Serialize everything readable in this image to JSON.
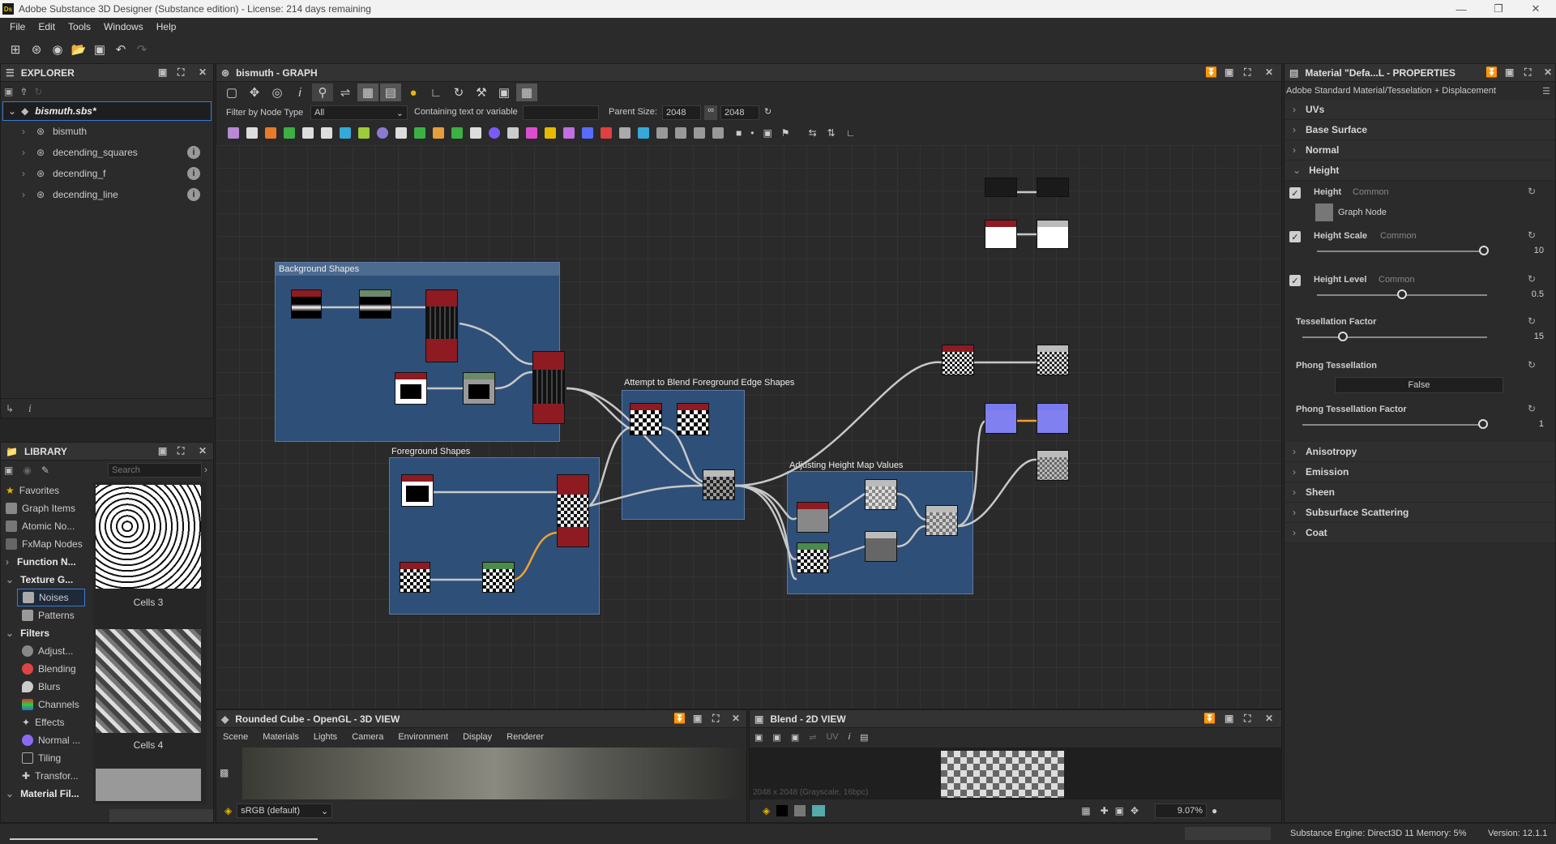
{
  "window": {
    "title": "Adobe Substance 3D Designer (Substance edition) - License: 214 days remaining",
    "logo": "Ds"
  },
  "menu": [
    "File",
    "Edit",
    "Tools",
    "Windows",
    "Help"
  ],
  "explorer": {
    "title": "EXPLORER",
    "file": "bismuth.sbs*",
    "items": [
      "bismuth",
      "decending_squares",
      "decending_f",
      "decending_line"
    ]
  },
  "library": {
    "title": "LIBRARY",
    "search_placeholder": "Search",
    "categories": [
      "Favorites",
      "Graph Items",
      "Atomic No...",
      "FxMap Nodes",
      "Function N...",
      "Texture G...",
      "Noises",
      "Patterns",
      "Filters",
      "Adjust...",
      "Blending",
      "Blurs",
      "Channels",
      "Effects",
      "Normal ...",
      "Tiling",
      "Transfor...",
      "Material Fil..."
    ],
    "thumbs": [
      "Cells 3",
      "Cells 4"
    ]
  },
  "graph": {
    "title": "bismuth - GRAPH",
    "filter_label": "Filter by Node Type",
    "filter_value": "All",
    "containing_label": "Containing text or variable",
    "parent_size_label": "Parent Size:",
    "parent_size": "2048",
    "size2": "2048",
    "frames": [
      "Background Shapes",
      "Foreground Shapes",
      "Attempt to Blend Foreground Edge Shapes",
      "Adjusting Height Map Values"
    ]
  },
  "view3d": {
    "title": "Rounded Cube - OpenGL - 3D VIEW",
    "menu": [
      "Scene",
      "Materials",
      "Lights",
      "Camera",
      "Environment",
      "Display",
      "Renderer"
    ],
    "colorspace": "sRGB (default)"
  },
  "view2d": {
    "title": "Blend - 2D VIEW",
    "uv": "UV",
    "info": "2048 x 2048 (Grayscale, 16bpc)",
    "zoom": "9.07%"
  },
  "properties": {
    "title": "Material \"Defa...L - PROPERTIES",
    "subtitle": "Adobe Standard Material/Tesselation + Displacement",
    "sections_top": [
      "UVs",
      "Base Surface",
      "Normal",
      "Height"
    ],
    "height": {
      "label": "Height",
      "tag": "Common",
      "value": "Graph Node"
    },
    "height_scale": {
      "label": "Height Scale",
      "tag": "Common",
      "value": "10",
      "level": 0.98
    },
    "height_level": {
      "label": "Height Level",
      "tag": "Common",
      "value": "0.5",
      "level": 0.5
    },
    "tess_factor": {
      "label": "Tessellation Factor",
      "value": "15",
      "level": 0.22
    },
    "phong": {
      "label": "Phong Tessellation",
      "value": "False"
    },
    "phong_factor": {
      "label": "Phong Tessellation Factor",
      "value": "1",
      "level": 0.98
    },
    "sections_bottom": [
      "Anisotropy",
      "Emission",
      "Sheen",
      "Subsurface Scattering",
      "Coat"
    ]
  },
  "status": {
    "engine": "Substance Engine: Direct3D 11 Memory: 5%",
    "version": "Version: 12.1.1"
  },
  "colors": {
    "accent": "#2e4f78",
    "node_header": "#8e1b22",
    "wire": "#c8c8c8",
    "wire_orange": "#f0a030"
  }
}
